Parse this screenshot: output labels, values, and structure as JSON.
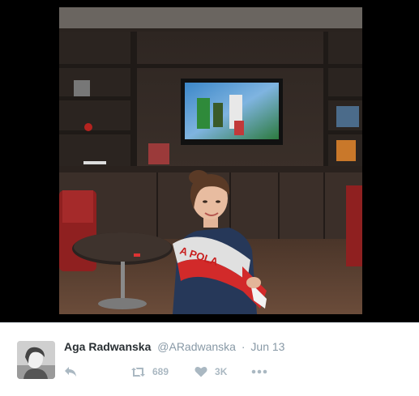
{
  "tweet": {
    "display_name": "Aga Radwanska",
    "handle": "@ARadwanska",
    "separator": "·",
    "date": "Jun 13",
    "retweet_count": "689",
    "like_count": "3K"
  },
  "photo": {
    "scarf_text": "A POLA"
  },
  "icons": {
    "reply": "reply-icon",
    "retweet": "retweet-icon",
    "like": "heart-icon",
    "more": "more-icon"
  },
  "colors": {
    "name": "#292f33",
    "meta": "#8899a6",
    "action_icon": "#aab8c2",
    "media_background": "#000000"
  }
}
